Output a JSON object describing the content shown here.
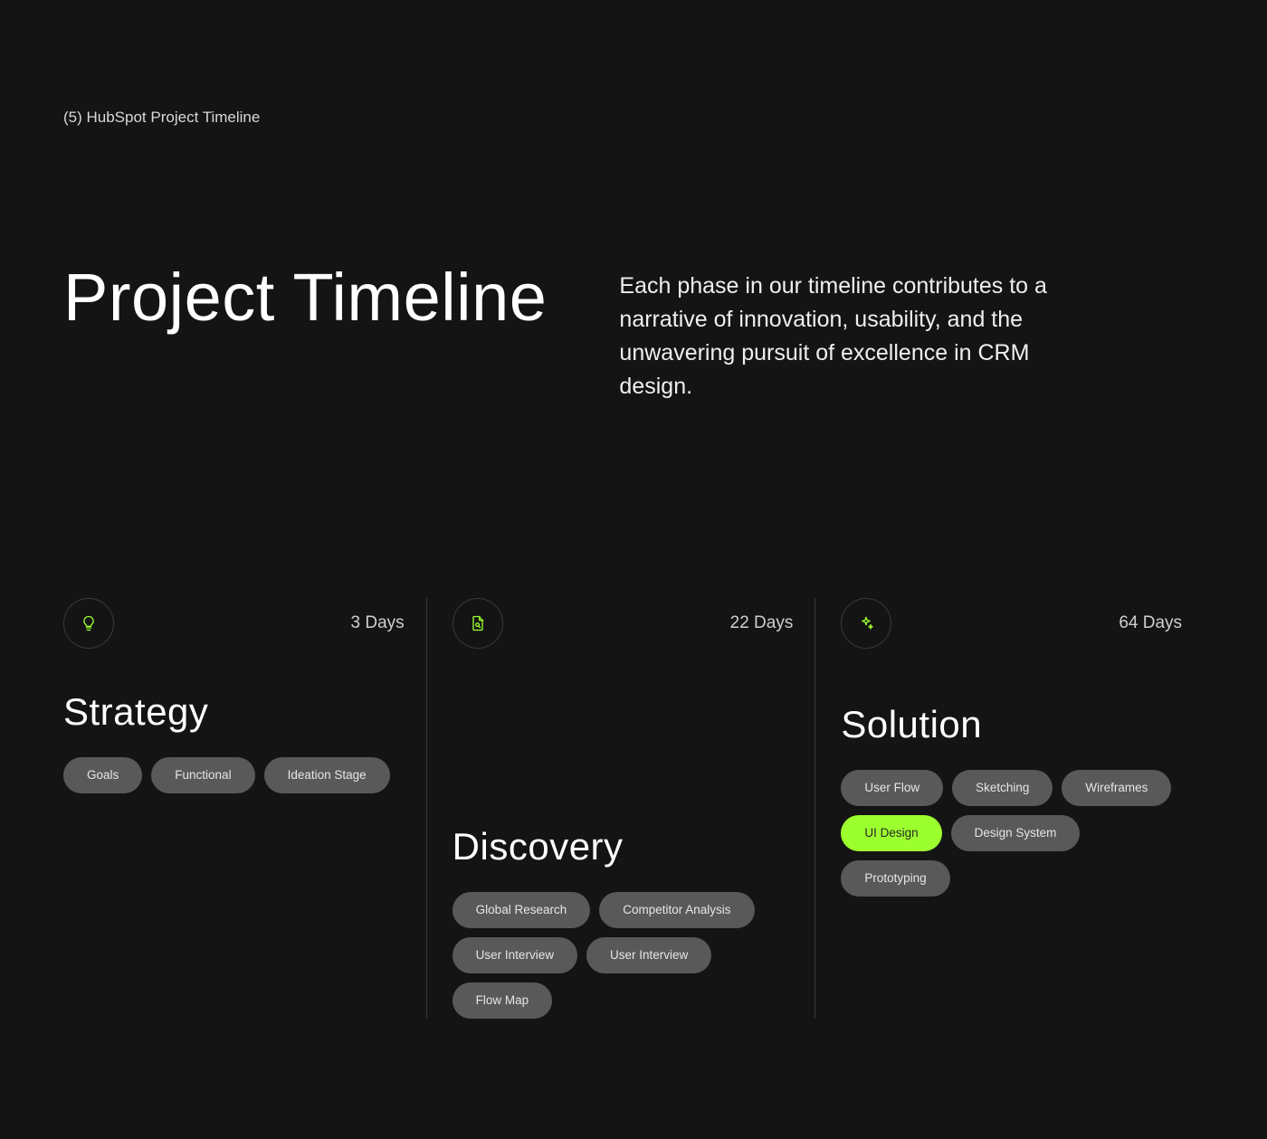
{
  "eyebrow": "(5) HubSpot Project Timeline",
  "hero": {
    "title": "Project Timeline",
    "description": "Each phase in our timeline contributes to a narrative of innovation, usability, and the unwavering pursuit of excellence in CRM design."
  },
  "phases": [
    {
      "id": "strategy",
      "icon": "bulb-icon",
      "duration": "3 Days",
      "title": "Strategy",
      "offset": false,
      "pills": [
        {
          "label": "Goals",
          "accent": false
        },
        {
          "label": "Functional",
          "accent": false
        },
        {
          "label": "Ideation Stage",
          "accent": false
        }
      ]
    },
    {
      "id": "discovery",
      "icon": "file-search-icon",
      "duration": "22 Days",
      "title": "Discovery",
      "offset": true,
      "pills": [
        {
          "label": "Global Research",
          "accent": false
        },
        {
          "label": "Competitor Analysis",
          "accent": false
        },
        {
          "label": "User Interview",
          "accent": false
        },
        {
          "label": "User Interview",
          "accent": false
        },
        {
          "label": "Flow Map",
          "accent": false
        }
      ]
    },
    {
      "id": "solution",
      "icon": "sparkle-icon",
      "duration": "64 Days",
      "title": "Solution",
      "offset": false,
      "solution": true,
      "pills": [
        {
          "label": "User Flow",
          "accent": false
        },
        {
          "label": "Sketching",
          "accent": false
        },
        {
          "label": "Wireframes",
          "accent": false
        },
        {
          "label": "UI Design",
          "accent": true
        },
        {
          "label": "Design System",
          "accent": false
        },
        {
          "label": "Prototyping",
          "accent": false
        }
      ]
    }
  ]
}
